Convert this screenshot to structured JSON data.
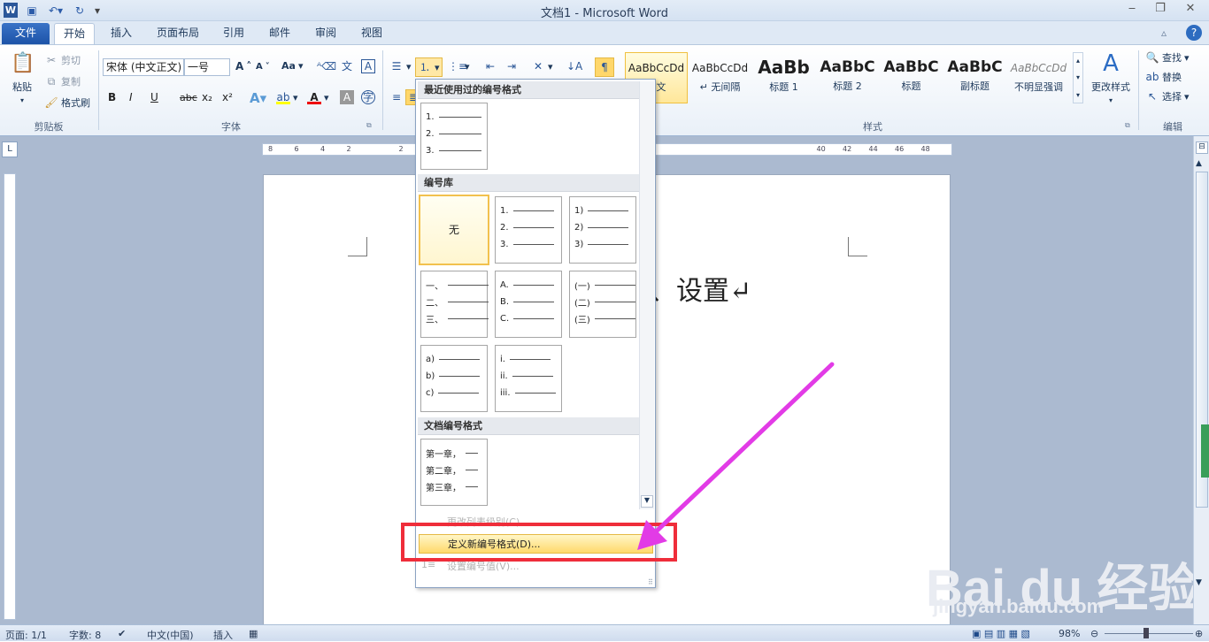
{
  "window": {
    "title": "文档1 - Microsoft Word"
  },
  "tabs": [
    "文件",
    "开始",
    "插入",
    "页面布局",
    "引用",
    "邮件",
    "审阅",
    "视图"
  ],
  "clipboard": {
    "paste": "粘贴",
    "cut": "剪切",
    "copy": "复制",
    "format_painter": "格式刷",
    "group_label": "剪贴板"
  },
  "font": {
    "name": "宋体 (中文正文)",
    "size": "一号",
    "group_label": "字体",
    "grow": "A",
    "shrink": "A",
    "change_case": "Aa",
    "bold": "B",
    "italic": "I",
    "underline": "U",
    "strike": "abc",
    "sub": "x₂",
    "sup": "x²",
    "font_color": "A"
  },
  "styles": {
    "group_label": "样式",
    "change_styles": "更改样式",
    "items": [
      {
        "sample": "AaBbCcDd",
        "name": "正文"
      },
      {
        "sample": "AaBbCcDd",
        "name": "↵ 无间隔"
      },
      {
        "sample": "AaBb",
        "name": "标题 1"
      },
      {
        "sample": "AaBbC",
        "name": "标题 2"
      },
      {
        "sample": "AaBbC",
        "name": "标题"
      },
      {
        "sample": "AaBbC",
        "name": "副标题"
      },
      {
        "sample": "AaBbCcDd",
        "name": "不明显强调"
      }
    ]
  },
  "editing": {
    "find": "查找",
    "replace": "替换",
    "select": "选择",
    "group_label": "编辑"
  },
  "ruler": {
    "ticks": [
      "8",
      "6",
      "4",
      "2",
      "",
      "2",
      "",
      "",
      "",
      "",
      "",
      "",
      "",
      "",
      "",
      "",
      "",
      "",
      "",
      "",
      "",
      "40",
      "42",
      "44",
      "46",
      "48"
    ]
  },
  "document": {
    "visible_text": "、设置↵"
  },
  "numbering_menu": {
    "recent_header": "最近使用过的编号格式",
    "library_header": "编号库",
    "document_header": "文档编号格式",
    "none_label": "无",
    "recent": [
      [
        "1.",
        "2.",
        "3."
      ]
    ],
    "library": [
      [
        "1.",
        "2.",
        "3."
      ],
      [
        "1)",
        "2)",
        "3)"
      ],
      [
        "一、",
        "二、",
        "三、"
      ],
      [
        "A.",
        "B.",
        "C."
      ],
      [
        "(一)",
        "(二)",
        "(三)"
      ],
      [
        "a)",
        "b)",
        "c)"
      ],
      [
        "i.",
        "ii.",
        "iii."
      ]
    ],
    "document_formats": [
      [
        "第一章，",
        "第二章，",
        "第三章，"
      ]
    ],
    "items": {
      "change_level": "更改列表级别(C)",
      "define_new": "定义新编号格式(D)...",
      "set_value": "设置编号值(V)..."
    }
  },
  "status": {
    "page": "页面: 1/1",
    "words": "字数: 8",
    "language": "中文(中国)",
    "insert": "插入",
    "zoom": "98%"
  },
  "watermark": {
    "brand": "Bai du 经验",
    "url": "jingyan.baidu.com"
  },
  "colors": {
    "highlight": "#ef2d3a",
    "arrow": "#e23be6",
    "accent": "#1d53a8"
  }
}
